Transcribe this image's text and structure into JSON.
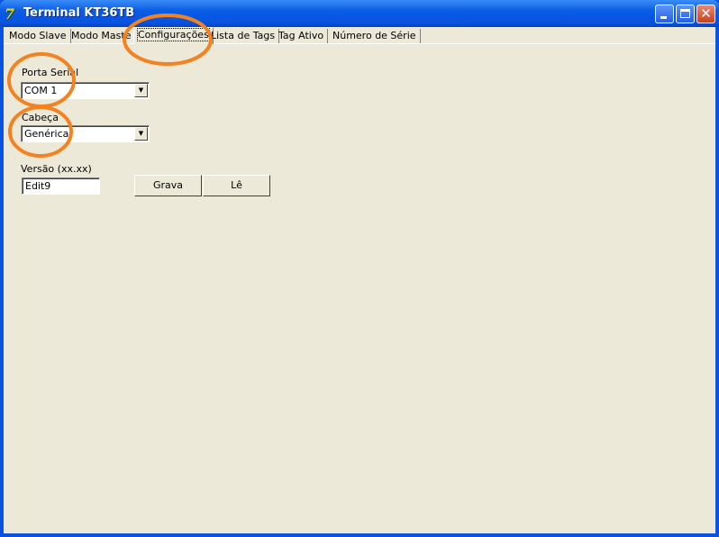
{
  "window": {
    "title": "Terminal KT36TB",
    "app_icon": "delphi-icon",
    "controls": {
      "minimize": "minimize-icon",
      "maximize": "maximize-icon",
      "close": "close-icon"
    }
  },
  "tabs": [
    {
      "label": "Modo Slave",
      "active": false
    },
    {
      "label": "Modo Maste",
      "active": false
    },
    {
      "label": "Configurações",
      "active": true
    },
    {
      "label": "Lista de Tags",
      "active": false
    },
    {
      "label": "Tag Ativo",
      "active": false
    },
    {
      "label": "Número de Série",
      "active": false
    }
  ],
  "config": {
    "porta_serial": {
      "label": "Porta Serial",
      "value": "COM 1"
    },
    "cabeca": {
      "label": "Cabeça",
      "value": "Genérica"
    },
    "versao": {
      "label": "Versão (xx.xx)",
      "value": "Edit9"
    },
    "grava_label": "Grava",
    "le_label": "Lê"
  },
  "annotation_color": "#F58220"
}
